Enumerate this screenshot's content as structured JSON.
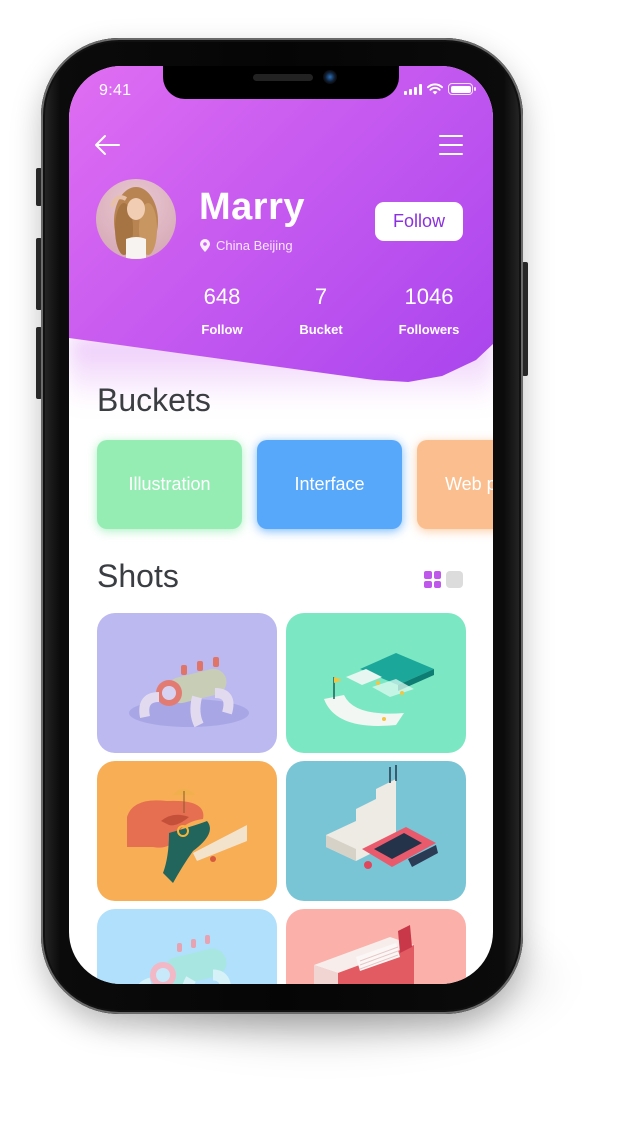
{
  "status_bar": {
    "time": "9:41"
  },
  "nav": {
    "back_icon": "arrow-left-icon",
    "menu_icon": "hamburger-menu-icon"
  },
  "profile": {
    "name": "Marry",
    "location": "China Beijing",
    "location_icon": "map-pin-icon",
    "follow_button": "Follow",
    "stats": [
      {
        "value": "648",
        "label": "Follow"
      },
      {
        "value": "7",
        "label": "Bucket"
      },
      {
        "value": "1046",
        "label": "Followers"
      }
    ]
  },
  "buckets": {
    "title": "Buckets",
    "items": [
      {
        "label": "Illustration",
        "color": "#96edb4"
      },
      {
        "label": "Interface",
        "color": "#57a7fb"
      },
      {
        "label": "Web p",
        "color": "#fbbe8e"
      }
    ]
  },
  "shots": {
    "title": "Shots",
    "view_toggle": {
      "active": "grid",
      "options": [
        "grid",
        "list"
      ]
    },
    "items": [
      {
        "subject": "pipe creature illustration",
        "bg": "#bbb9f0"
      },
      {
        "subject": "tennis court and golf illustration",
        "bg": "#7be7c3"
      },
      {
        "subject": "pool number 2 illustration",
        "bg": "#f7ae55"
      },
      {
        "subject": "stairs and pool illustration",
        "bg": "#79c5d6"
      },
      {
        "subject": "blue pipe creature illustration",
        "bg": "#b0e0fb"
      },
      {
        "subject": "red building illustration",
        "bg": "#fbb0aa"
      }
    ]
  },
  "colors": {
    "header_gradient_start": "#e06ef3",
    "header_gradient_end": "#a844ee",
    "accent": "#bf57ec",
    "follow_text": "#8b2fe0",
    "title_text": "#3a3d42"
  }
}
